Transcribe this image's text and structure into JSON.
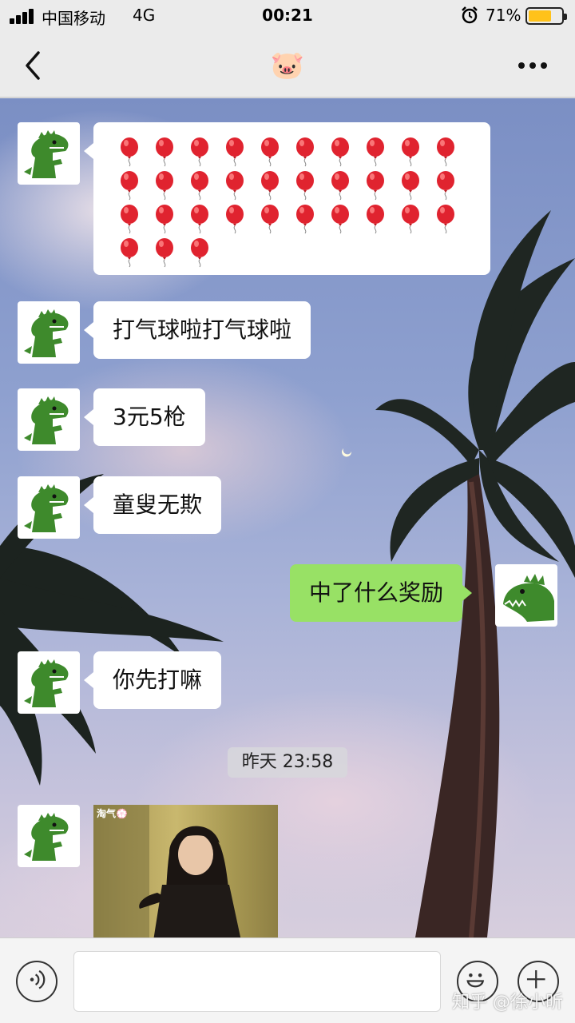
{
  "status_bar": {
    "carrier": "中国移动",
    "network": "4G",
    "time": "00:21",
    "battery_percent": "71%",
    "battery_level": 0.71,
    "signal_icon": "signal-bars-icon",
    "alarm_icon": "alarm-clock-icon"
  },
  "nav": {
    "title": "🐷",
    "back_icon": "chevron-left-icon",
    "more_icon": "more-dots-icon"
  },
  "messages": [
    {
      "side": "left",
      "type": "emoji",
      "text": "🎈🎈🎈🎈🎈🎈🎈🎈🎈🎈🎈🎈🎈🎈🎈🎈🎈🎈🎈🎈🎈🎈🎈🎈🎈🎈🎈🎈🎈🎈🎈🎈🎈",
      "balloon_count": 33
    },
    {
      "side": "left",
      "type": "text",
      "text": "打气球啦打气球啦"
    },
    {
      "side": "left",
      "type": "text",
      "text": "3元5枪"
    },
    {
      "side": "left",
      "type": "text",
      "text": "童叟无欺"
    },
    {
      "side": "right",
      "type": "text",
      "text": "中了什么奖励"
    },
    {
      "side": "left",
      "type": "text",
      "text": "你先打嘛"
    },
    {
      "type": "timestamp",
      "text": "昨天 23:58"
    },
    {
      "side": "left",
      "type": "image",
      "tag": "淘气💮"
    }
  ],
  "input_bar": {
    "voice_icon": "voice-icon",
    "emoji_icon": "smiley-icon",
    "plus_icon": "plus-icon",
    "input_value": ""
  },
  "watermark": "知乎 @徐小昕",
  "colors": {
    "outgoing_bubble": "#98e165",
    "incoming_bubble": "#ffffff",
    "battery": "#ffc21a",
    "dino": "#3e8a2c"
  }
}
